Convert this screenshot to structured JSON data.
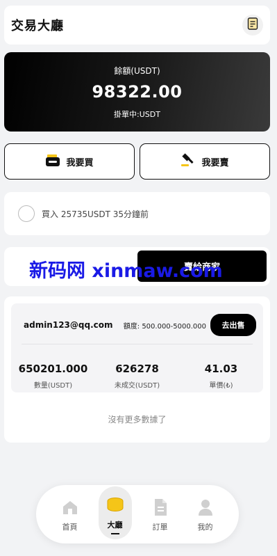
{
  "header": {
    "title": "交易大廳",
    "notes_icon": "notepad-icon"
  },
  "balance": {
    "label": "餘額(USDT)",
    "amount": "98322.00",
    "pending": "掛單中:USDT"
  },
  "actions": {
    "buy_label": "我要買",
    "sell_label": "我要賣"
  },
  "notice": {
    "text": "買入 25735USDT 35分鐘前"
  },
  "tabs": {
    "merchant_label": "賣給商家",
    "watermark": "新码网 xinmaw.com"
  },
  "order": {
    "email": "admin123@qq.com",
    "limit_label": "額度: 500.000-5000.000",
    "action_label": "去出售",
    "stats": [
      {
        "value": "650201.000",
        "label": "數量(USDT)"
      },
      {
        "value": "626278",
        "label": "未成交(USDT)"
      },
      {
        "value": "41.03",
        "label": "單價(₺)"
      }
    ]
  },
  "list": {
    "empty_text": "沒有更多數據了"
  },
  "nav": {
    "items": [
      {
        "label": "首頁",
        "icon": "home-icon"
      },
      {
        "label": "大廳",
        "icon": "coins-icon",
        "active": true
      },
      {
        "label": "訂單",
        "icon": "document-icon"
      },
      {
        "label": "我的",
        "icon": "user-icon"
      }
    ]
  },
  "colors": {
    "accent": "#000000",
    "coin": "#f5c518",
    "watermark": "#1a1ae6"
  }
}
